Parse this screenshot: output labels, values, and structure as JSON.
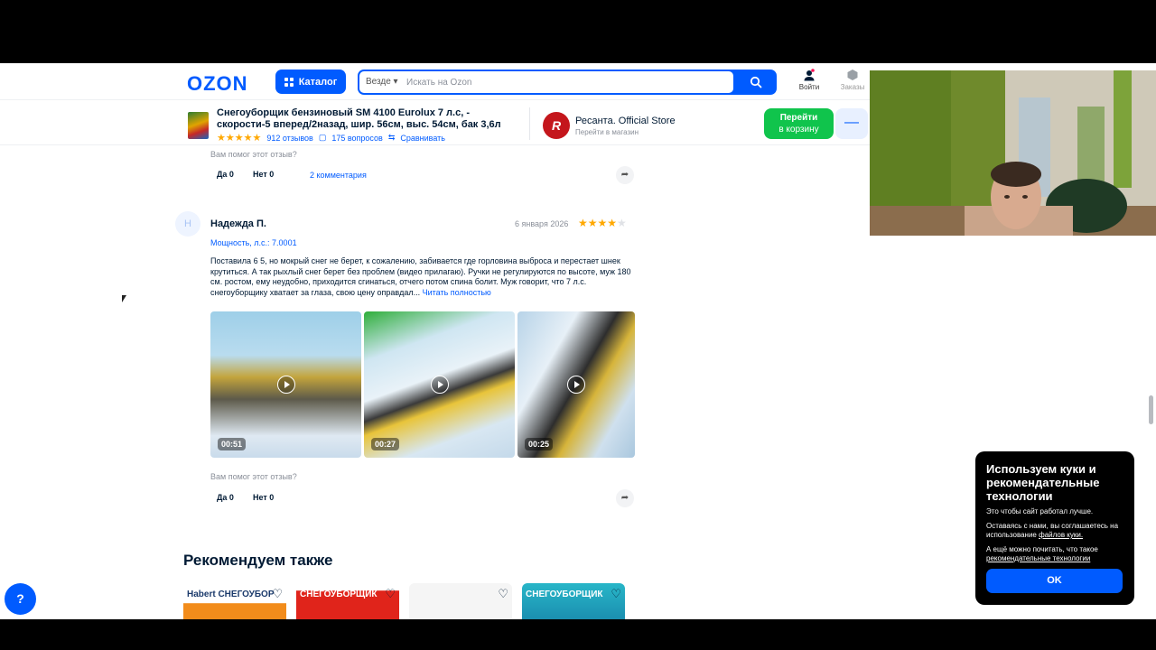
{
  "header": {
    "logo": "OZON",
    "catalog_label": "Каталог",
    "search_scope": "Везде",
    "search_placeholder": "Искать на Ozon",
    "login_label": "Войти",
    "orders_label": "Заказы"
  },
  "product_bar": {
    "title": "Снегоуборщик бензиновый SM 4100 Euroluх 7 л.с, - скорости-5 вперед/2назад, шир. 56см, выс. 54см, бак 3,6л",
    "reviews": "912 отзывов",
    "questions": "175 вопросов",
    "compare": "Сравнивать",
    "store_name": "Ресанта. Official Store",
    "store_link": "Перейти в магазин",
    "cart_line1": "Перейти",
    "cart_line2": "в корзину",
    "minus_label": "—"
  },
  "prev_review": {
    "helpful_label": "Вам помог этот отзыв?",
    "yes_label": "Да 0",
    "no_label": "Нет 0",
    "comments": "2 комментария"
  },
  "review": {
    "avatar_initial": "Н",
    "author": "Надежда П.",
    "date": "6 января 2026",
    "rating": 4,
    "variant": "Мощность, л.с.: 7.0001",
    "text": "Поставила 6 5, но мокрый снег не берет, к сожалению, забивается где горловина выброса и перестает шнек крутиться. А так рыхлый снег берет без проблем (видео прилагаю). Ручки не регулируются по высоте, муж 180 см. ростом, ему неудобно, приходится сгинаться, отчего потом спина болит. Муж говорит, что 7 л.с. снегоуборщику хватает за глаза, свою цену оправдал...",
    "read_more": "Читать полностью",
    "videos": [
      {
        "duration": "00:51"
      },
      {
        "duration": "00:27"
      },
      {
        "duration": "00:25"
      }
    ],
    "helpful_label": "Вам помог этот отзыв?",
    "yes_label": "Да 0",
    "no_label": "Нет 0"
  },
  "recommend": {
    "title": "Рекомендуем также",
    "cards": [
      {
        "label": "Habert  СНЕГОУБОР"
      },
      {
        "label": "СНЕГОУБОРЩИК"
      },
      {
        "label": ""
      },
      {
        "label": "СНЕГОУБОРЩИК"
      }
    ]
  },
  "cookie": {
    "title": "Используем куки и рекомендательные технологии",
    "p1": "Это чтобы сайт работал лучше.",
    "p2_prefix": "Оставаясь с нами, вы соглашаетесь на использование ",
    "p2_link": "файлов куки.",
    "p3_prefix": "А ещё можно почитать, что такое ",
    "p3_link": "рекомендательные технологии",
    "ok_label": "OK"
  },
  "colors": {
    "brand": "#005bff",
    "cart": "#10c44c",
    "star": "#ffa800"
  }
}
